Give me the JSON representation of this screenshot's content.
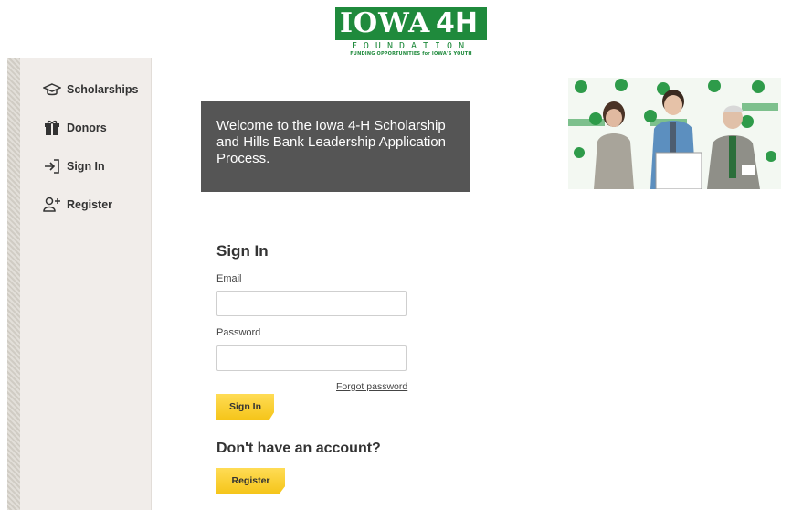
{
  "header": {
    "logo_main": "IOWA",
    "logo_mark": "4H",
    "logo_sub": "FOUNDATION",
    "logo_tagline": "FUNDING OPPORTUNITIES for IOWA'S YOUTH"
  },
  "sidebar": {
    "items": [
      {
        "label": "Scholarships",
        "icon": "graduation-cap-icon"
      },
      {
        "label": "Donors",
        "icon": "gift-icon"
      },
      {
        "label": "Sign In",
        "icon": "sign-in-icon"
      },
      {
        "label": "Register",
        "icon": "user-plus-icon"
      }
    ]
  },
  "welcome": {
    "text": "Welcome to the Iowa 4-H Scholarship and Hills Bank Leadership Application Process."
  },
  "signin": {
    "title": "Sign In",
    "email_label": "Email",
    "email_value": "",
    "password_label": "Password",
    "password_value": "",
    "forgot_label": "Forgot password",
    "submit_label": "Sign In"
  },
  "register": {
    "prompt": "Don't have an account?",
    "button_label": "Register"
  },
  "colors": {
    "brand_green": "#1f8a3c",
    "button_yellow": "#f5c51a",
    "banner_gray": "#555555",
    "sidebar_bg": "#f1edea"
  }
}
